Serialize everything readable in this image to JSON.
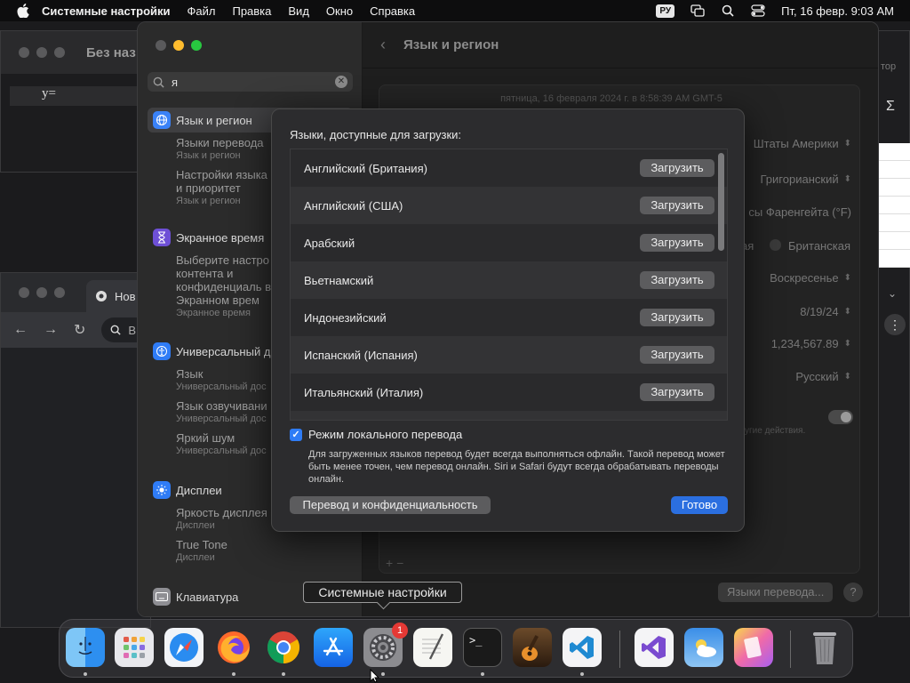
{
  "menubar": {
    "app_name": "Системные настройки",
    "items": [
      "Файл",
      "Правка",
      "Вид",
      "Окно",
      "Справка"
    ],
    "input_source": "РУ",
    "clock": "Пт, 16 февр.  9:03 AM"
  },
  "background": {
    "calc_title": "Без наз",
    "calc_formula": "y=",
    "chrome_tab": "Нов",
    "chrome_omnibox": "В",
    "right_partial_label": "тор",
    "right_sigma": "Σ",
    "right_chevron": "⌄",
    "right_more": "⋮"
  },
  "settings": {
    "search_value": "я",
    "sidebar": [
      {
        "label": "Язык и регион",
        "icon": "globe-icon",
        "color": "#3a82f7",
        "selected": true,
        "subs": [
          {
            "title": "Языки перевода",
            "subtitle": "Язык и регион"
          },
          {
            "title": "Настройки языка и приоритет",
            "subtitle": "Язык и регион"
          }
        ]
      },
      {
        "label": "Экранное время",
        "icon": "hourglass-icon",
        "color": "#6e50d6",
        "selected": false,
        "subs": [
          {
            "title": "Выберите настро контента и конфиденциаль в Экранном врем",
            "subtitle": "Экранное время"
          }
        ]
      },
      {
        "label": "Универсальный д",
        "icon": "accessibility-icon",
        "color": "#2f7cf6",
        "selected": false,
        "subs": [
          {
            "title": "Язык",
            "subtitle": "Универсальный дос"
          },
          {
            "title": "Язык озвучивани",
            "subtitle": "Универсальный дос"
          },
          {
            "title": "Яркий шум",
            "subtitle": "Универсальный дос"
          }
        ]
      },
      {
        "label": "Дисплеи",
        "icon": "sun-icon",
        "color": "#2f7cf6",
        "selected": false,
        "subs": [
          {
            "title": "Яркость дисплея",
            "subtitle": "Дисплеи"
          },
          {
            "title": "True Tone",
            "subtitle": "Дисплеи"
          }
        ]
      },
      {
        "label": "Клавиатура",
        "icon": "keyboard-icon",
        "color": "#8e8e93",
        "selected": false,
        "subs": []
      }
    ],
    "header_title": "Язык и регион",
    "date_line": "пятница, 16 февраля 2024 г. в 8:58:39 AM GMT-5",
    "region_value": "Штаты Америки",
    "calendar_value": "Григорианский",
    "temperature_value": "сы Фаренгейта (°F)",
    "measure_left": "ая",
    "measure_right": "Британская",
    "first_day_value": "Воскресенье",
    "date_format_value": "8/19/24",
    "number_format_value": "1,234,567.89",
    "list_sort_value": "Русский",
    "actions_note": "угие действия.",
    "plus_minus": "+   −",
    "translation_langs_button": "Языки перевода...",
    "help": "?"
  },
  "sheet": {
    "heading": "Языки, доступные для загрузки:",
    "download_label": "Загрузить",
    "languages": [
      "Английский (Британия)",
      "Английский (США)",
      "Арабский",
      "Вьетнамский",
      "Индонезийский",
      "Испанский (Испания)",
      "Итальянский (Италия)"
    ],
    "on_device_mode_label": "Режим локального перевода",
    "on_device_mode_checked": true,
    "note": "Для загруженных языков перевод будет всегда выполняться офлайн. Такой перевод может быть менее точен, чем перевод онлайн. Siri и Safari будут всегда обрабатывать переводы онлайн.",
    "privacy_button": "Перевод и конфиденциальность",
    "done_button": "Готово"
  },
  "tooltip": "Системные настройки",
  "dock": {
    "apps": [
      "finder-icon",
      "launchpad-icon",
      "safari-icon",
      "firefox-icon",
      "chrome-icon",
      "app-store-icon",
      "system-settings-icon",
      "textedit-icon",
      "terminal-icon",
      "garageband-icon",
      "vscode-icon",
      "visual-studio-icon",
      "weather-icon",
      "pages-icon",
      "trash-icon"
    ],
    "settings_badge": "1"
  },
  "colors": {
    "accent": "#2b6fe0",
    "close": "#ff5f57",
    "minimize": "#febc2e",
    "zoom": "#28c840"
  }
}
